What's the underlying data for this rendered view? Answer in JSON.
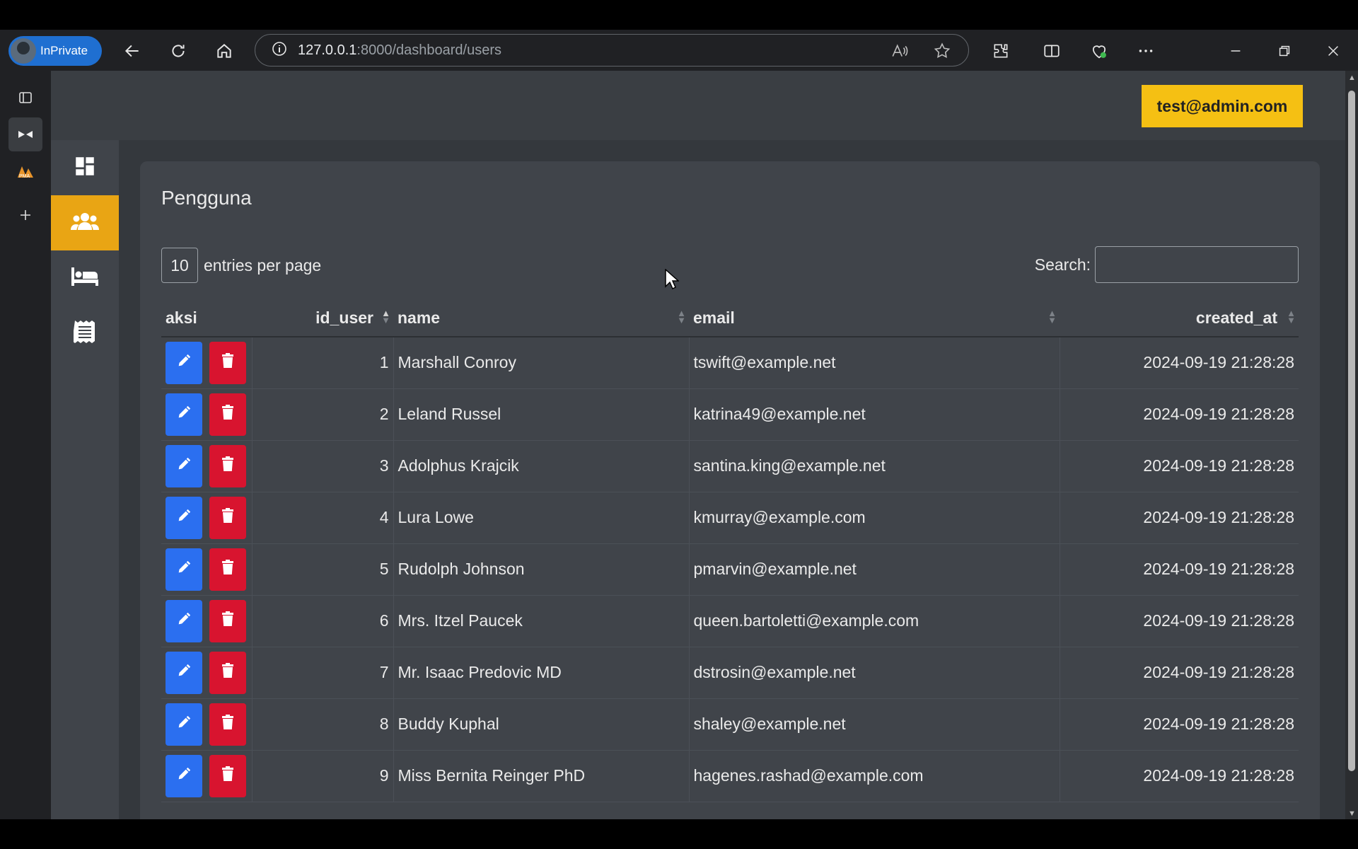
{
  "browser": {
    "profile_label": "InPrivate",
    "url_host": "127.0.0.1",
    "url_path": ":8000/dashboard/users"
  },
  "header": {
    "user_email": "test@admin.com"
  },
  "card": {
    "title": "Pengguna",
    "entries_value": "10",
    "entries_label": "entries per page",
    "search_label": "Search:"
  },
  "table": {
    "columns": [
      "aksi",
      "id_user",
      "name",
      "email",
      "created_at"
    ],
    "rows": [
      {
        "id": "1",
        "name": "Marshall Conroy",
        "email": "tswift@example.net",
        "created_at": "2024-09-19 21:28:28"
      },
      {
        "id": "2",
        "name": "Leland Russel",
        "email": "katrina49@example.net",
        "created_at": "2024-09-19 21:28:28"
      },
      {
        "id": "3",
        "name": "Adolphus Krajcik",
        "email": "santina.king@example.net",
        "created_at": "2024-09-19 21:28:28"
      },
      {
        "id": "4",
        "name": "Lura Lowe",
        "email": "kmurray@example.com",
        "created_at": "2024-09-19 21:28:28"
      },
      {
        "id": "5",
        "name": "Rudolph Johnson",
        "email": "pmarvin@example.net",
        "created_at": "2024-09-19 21:28:28"
      },
      {
        "id": "6",
        "name": "Mrs. Itzel Paucek",
        "email": "queen.bartoletti@example.com",
        "created_at": "2024-09-19 21:28:28"
      },
      {
        "id": "7",
        "name": "Mr. Isaac Predovic MD",
        "email": "dstrosin@example.net",
        "created_at": "2024-09-19 21:28:28"
      },
      {
        "id": "8",
        "name": "Buddy Kuphal",
        "email": "shaley@example.net",
        "created_at": "2024-09-19 21:28:28"
      },
      {
        "id": "9",
        "name": "Miss Bernita Reinger PhD",
        "email": "hagenes.rashad@example.com",
        "created_at": "2024-09-19 21:28:28"
      }
    ]
  },
  "colors": {
    "accent_yellow": "#f5c013",
    "active_orange": "#e9a514",
    "edit_blue": "#2b6ff0",
    "delete_red": "#d8142f"
  }
}
